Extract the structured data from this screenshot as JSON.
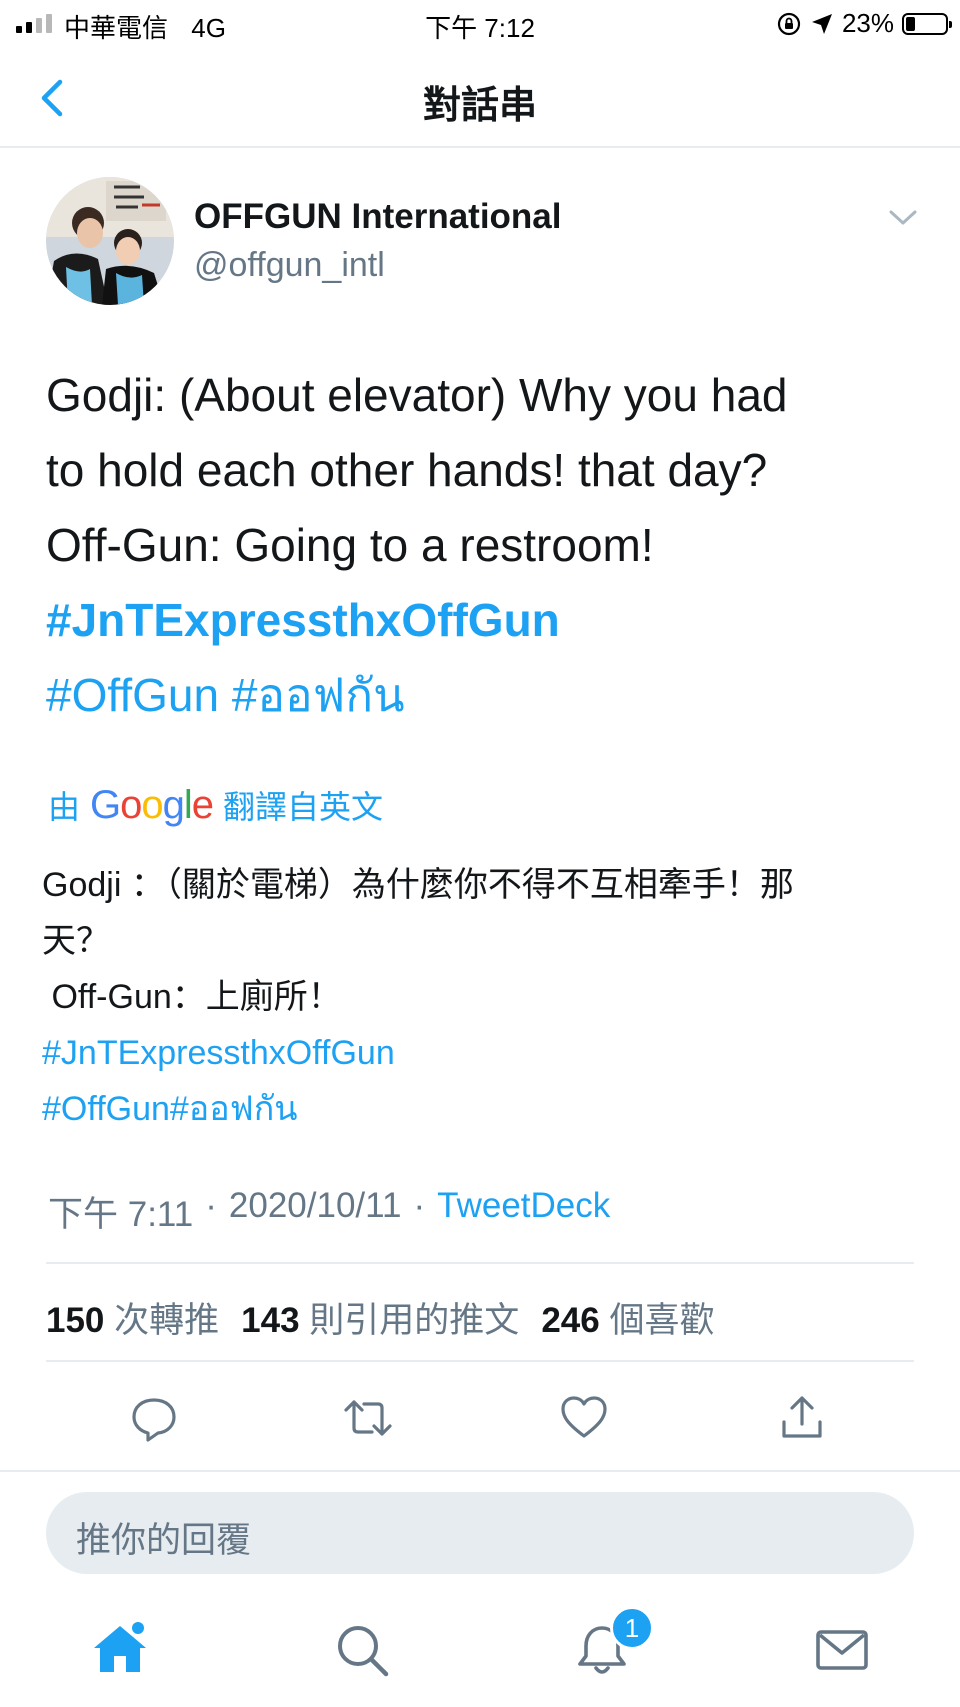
{
  "status_bar": {
    "carrier": "中華電信",
    "network": "4G",
    "time": "下午 7:12",
    "battery_label": "23%",
    "battery_level": 0.23,
    "signal_bars": 4,
    "signal_active": 2
  },
  "nav": {
    "title": "對話串"
  },
  "author": {
    "name": "OFFGUN International",
    "handle": "@offgun_intl"
  },
  "tweet": {
    "lines": [
      "Godji: (About elevator) Why you had",
      "to hold each other hands! that day?",
      "Off-Gun: Going to a restroom!"
    ],
    "hashtag_1": "#JnTExpressthxOffGun",
    "hashtag_2": "#OffGun",
    "hashtag_3": "#ออฟกัน"
  },
  "translation": {
    "prefix": "由",
    "google": "Google",
    "suffix": "翻譯自英文",
    "line_1": "Godji ：（關於電梯）為什麼你不得不互相牽手！那",
    "line_2": "天？",
    "line_3": " Off-Gun：上廁所！",
    "hashtag_1": "#JnTExpressthxOffGun",
    "hashtag_2": "#OffGun#ออฟกัน"
  },
  "meta": {
    "time": "下午 7:11",
    "separator": "·",
    "date": "2020/10/11",
    "source": "TweetDeck"
  },
  "stats": {
    "retweets_count": "150",
    "retweets_label": "次轉推",
    "quotes_count": "143",
    "quotes_label": "則引用的推文",
    "likes_count": "246",
    "likes_label": "個喜歡"
  },
  "reply": {
    "placeholder": "推你的回覆"
  },
  "tabbar": {
    "notifications_badge": "1"
  },
  "colors": {
    "accent": "#1da1f2",
    "text": "#14171a",
    "muted": "#657786",
    "divider": "#e6ecf0"
  }
}
